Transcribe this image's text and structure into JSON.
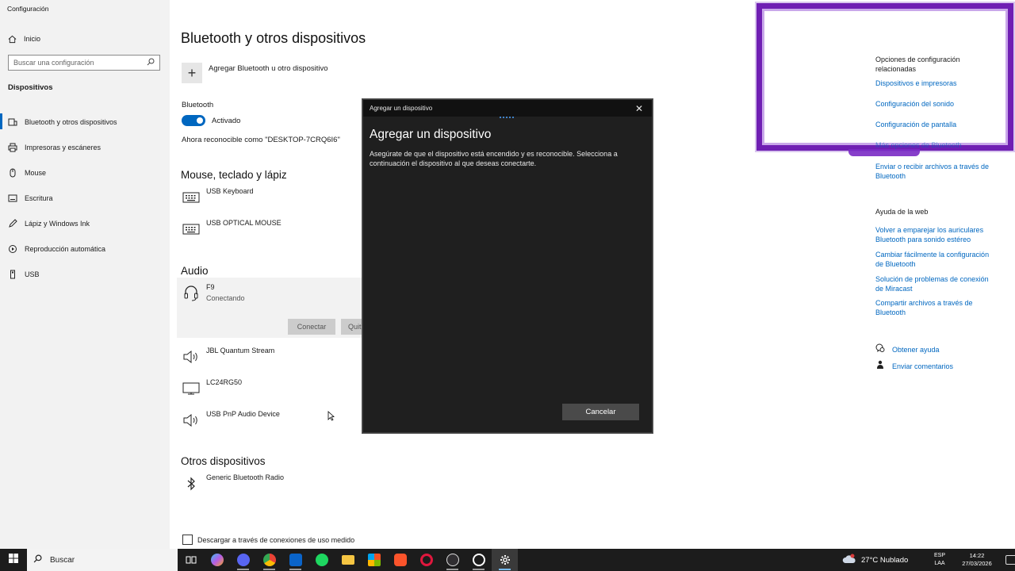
{
  "app_title": "Configuración",
  "sidebar": {
    "home_label": "Inicio",
    "search_placeholder": "Buscar una configuración",
    "section_title": "Dispositivos",
    "items": [
      {
        "label": "Bluetooth y otros dispositivos",
        "icon": "bluetooth-devices-icon"
      },
      {
        "label": "Impresoras y escáneres",
        "icon": "printer-icon"
      },
      {
        "label": "Mouse",
        "icon": "mouse-icon"
      },
      {
        "label": "Escritura",
        "icon": "keyboard-icon"
      },
      {
        "label": "Lápiz y Windows Ink",
        "icon": "pen-icon"
      },
      {
        "label": "Reproducción automática",
        "icon": "autoplay-icon"
      },
      {
        "label": "USB",
        "icon": "usb-icon"
      }
    ]
  },
  "main": {
    "title": "Bluetooth y otros dispositivos",
    "add_label": "Agregar Bluetooth u otro dispositivo",
    "bluetooth_label": "Bluetooth",
    "toggle_label": "Activado",
    "discoverable": "Ahora reconocible como \"DESKTOP-7CRQ6I6\"",
    "groups": {
      "input": "Mouse, teclado y lápiz",
      "audio": "Audio",
      "other": "Otros dispositivos"
    },
    "input_devices": [
      "USB Keyboard",
      "USB OPTICAL MOUSE"
    ],
    "audio_devices": [
      {
        "name": "F9",
        "status": "Conectando"
      },
      {
        "name": "JBL Quantum Stream"
      },
      {
        "name": "LC24RG50"
      },
      {
        "name": "USB PnP Audio Device"
      }
    ],
    "connect_btn": "Conectar",
    "remove_btn": "Quit",
    "other_devices": [
      "Generic Bluetooth Radio"
    ],
    "metered_label": "Descargar a través de conexiones de uso medido"
  },
  "related": {
    "title": "Opciones de configuración relacionadas",
    "links": [
      "Dispositivos e impresoras",
      "Configuración del sonido",
      "Configuración de pantalla",
      "Más opciones de Bluetooth",
      "Enviar o recibir archivos a través de Bluetooth"
    ],
    "web_title": "Ayuda de la web",
    "web_links": [
      "Volver a emparejar los auriculares Bluetooth para sonido estéreo",
      "Cambiar fácilmente la configuración de Bluetooth",
      "Solución de problemas de conexión de Miracast",
      "Compartir archivos a través de Bluetooth"
    ],
    "help": "Obtener ayuda",
    "feedback": "Enviar comentarios"
  },
  "dialog": {
    "window_title": "Agregar un dispositivo",
    "title": "Agregar un dispositivo",
    "description": "Asegúrate de que el dispositivo está encendido y es reconocible. Selecciona a continuación el dispositivo al que deseas conectarte.",
    "cancel": "Cancelar"
  },
  "taskbar": {
    "search": "Buscar",
    "weather": "27°C  Nublado",
    "lang1": "ESP",
    "lang2": "LAA",
    "time": "14:22",
    "date": "27/03/2026",
    "apps": [
      "task-view-icon",
      "copilot-icon",
      "discord-icon",
      "chrome-icon",
      "outlook-icon",
      "spotify-icon",
      "file-explorer-icon",
      "store-icon",
      "brave-icon",
      "opera-gx-icon",
      "obs-icon",
      "quick-assist-icon",
      "settings-icon"
    ]
  },
  "colors": {
    "accent": "#0067c0",
    "overlay": "#6f1fb3"
  }
}
